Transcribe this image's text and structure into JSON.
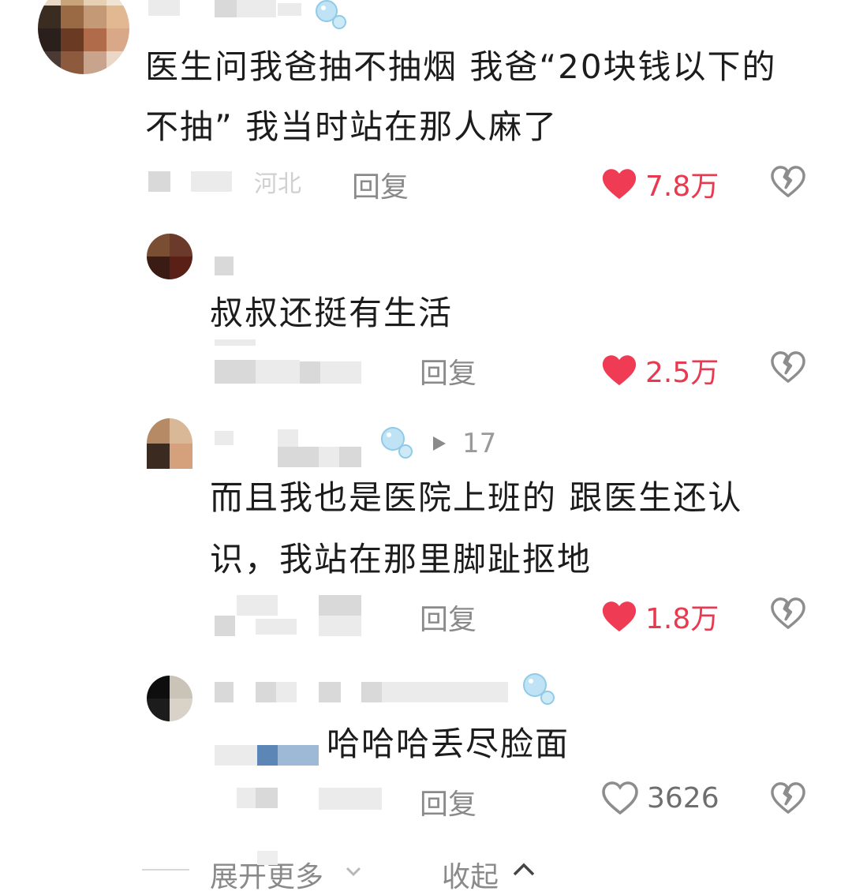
{
  "comments": [
    {
      "text_line1": "医生问我爸抽不抽烟 我爸“20块钱以下的",
      "text_line2": "不抽” 我当时站在那人麻了",
      "location": "河北",
      "reply_label": "回复",
      "likes": "7.8万",
      "liked": true
    },
    {
      "text_line1": "叔叔还挺有生活",
      "reply_label": "回复",
      "likes": "2.5万",
      "liked": true
    },
    {
      "play_count": "17",
      "text_line1": "而且我也是医院上班的 跟医生还认",
      "text_line2": "识，我站在那里脚趾抠地",
      "reply_label": "回复",
      "likes": "1.8万",
      "liked": true
    },
    {
      "text_line1": "哈哈哈丢尽脸面",
      "reply_label": "回复",
      "likes": "3626",
      "liked": false
    }
  ],
  "footer": {
    "expand_more": "展开更多",
    "collapse": "收起"
  },
  "colors": {
    "like_active": "#e8394f",
    "text_secondary": "#8a8a8a",
    "text_primary": "#1c1c1c"
  },
  "icons": {
    "like": "heart-icon",
    "dislike": "broken-heart-icon",
    "badge": "bubble-badge-icon",
    "play": "play-icon",
    "expand": "chevron-down-icon",
    "collapse": "chevron-up-icon"
  }
}
